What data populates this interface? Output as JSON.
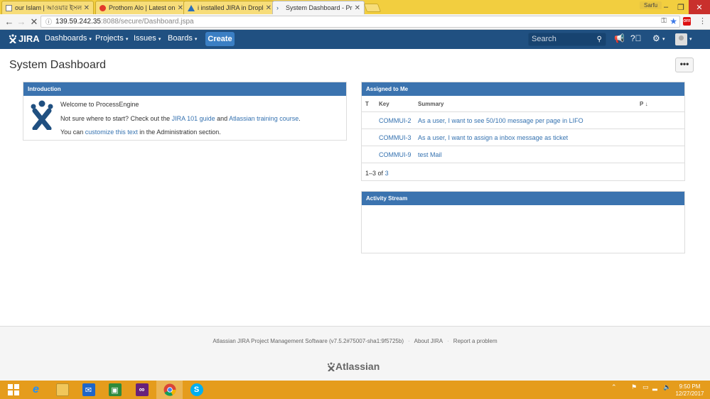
{
  "browser": {
    "tabs": [
      {
        "title": "our Islam | আওয়ার ইসলা"
      },
      {
        "title": "Prothom Alo | Latest onli"
      },
      {
        "title": "i installed JIRA in Droplet"
      },
      {
        "title": "System Dashboard - Proc"
      }
    ],
    "user": "Sarfu",
    "url_host": "139.59.242.35",
    "url_path": ":8088/secure/Dashboard.jspa",
    "extension_label": "OFF"
  },
  "header": {
    "logo_text": "JIRA",
    "nav": [
      "Dashboards",
      "Projects",
      "Issues",
      "Boards"
    ],
    "create_label": "Create",
    "search_placeholder": "Search"
  },
  "page": {
    "title": "System Dashboard",
    "more_label": "•••"
  },
  "introduction": {
    "heading": "Introduction",
    "welcome": "Welcome to ProcessEngine",
    "line2_pre": "Not sure where to start? Check out the ",
    "line2_link1": "JIRA 101 guide",
    "line2_mid": " and ",
    "line2_link2": "Atlassian training course",
    "line2_post": ".",
    "line3_pre": "You can ",
    "line3_link": "customize this text",
    "line3_post": " in the Administration section."
  },
  "assigned": {
    "heading": "Assigned to Me",
    "columns": {
      "t": "T",
      "key": "Key",
      "summary": "Summary",
      "p": "P"
    },
    "sort_arrow": "↓",
    "rows": [
      {
        "key": "COMMUI-2",
        "summary": "As a user, I want to see 50/100 message per page in LIFO"
      },
      {
        "key": "COMMUI-3",
        "summary": "As a user, I want to assign a inbox message as ticket"
      },
      {
        "key": "COMMUI-9",
        "summary": "test Mail"
      }
    ],
    "count_range": "1–3",
    "count_of": "of",
    "count_total": "3"
  },
  "activity": {
    "heading": "Activity Stream"
  },
  "footer": {
    "software": "Atlassian JIRA Project Management Software (v7.5.2#75007-sha1:9f5725b)",
    "about": "About JIRA",
    "report": "Report a problem",
    "logo": "Atlassian"
  },
  "taskbar": {
    "time": "9:50 PM",
    "date": "12/27/2017"
  },
  "colors": {
    "header": "#205081",
    "gadget_header": "#3b73af",
    "link": "#3572b0",
    "taskbar": "#e59c1c",
    "tabstrip": "#f2ce3f"
  }
}
